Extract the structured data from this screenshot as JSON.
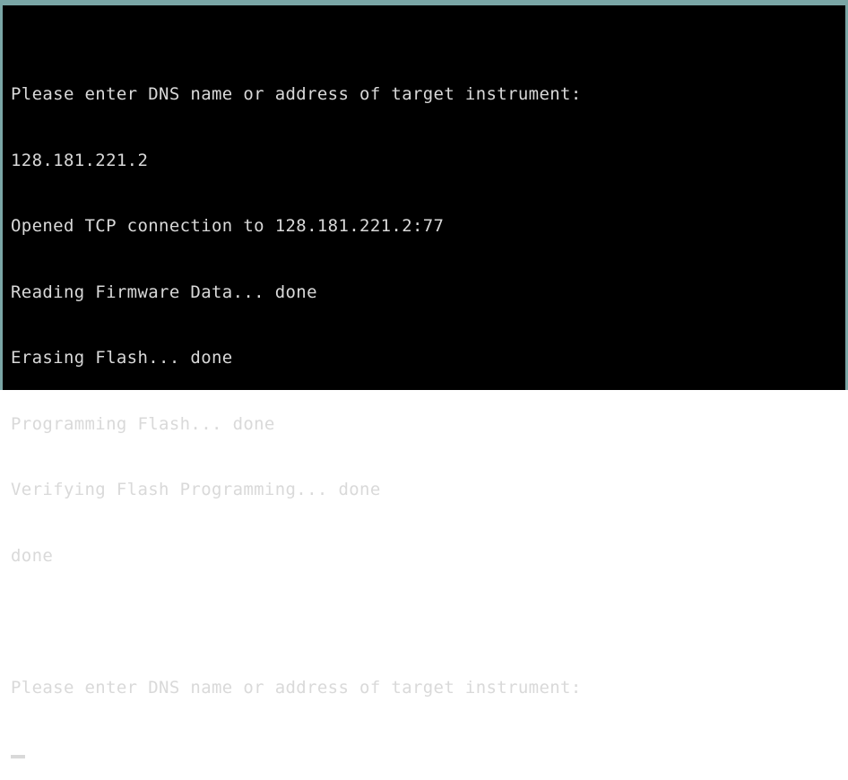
{
  "console": {
    "lines": [
      "Please enter DNS name or address of target instrument:",
      "128.181.221.2",
      "Opened TCP connection to 128.181.221.2:77",
      "Reading Firmware Data... done",
      "Erasing Flash... done",
      "Programming Flash... done",
      "Verifying Flash Programming... done",
      "done",
      "",
      "Please enter DNS name or address of target instrument:"
    ]
  },
  "colors": {
    "background": "#000000",
    "text": "#d9d9d9",
    "frame": "#7aa6a6"
  }
}
